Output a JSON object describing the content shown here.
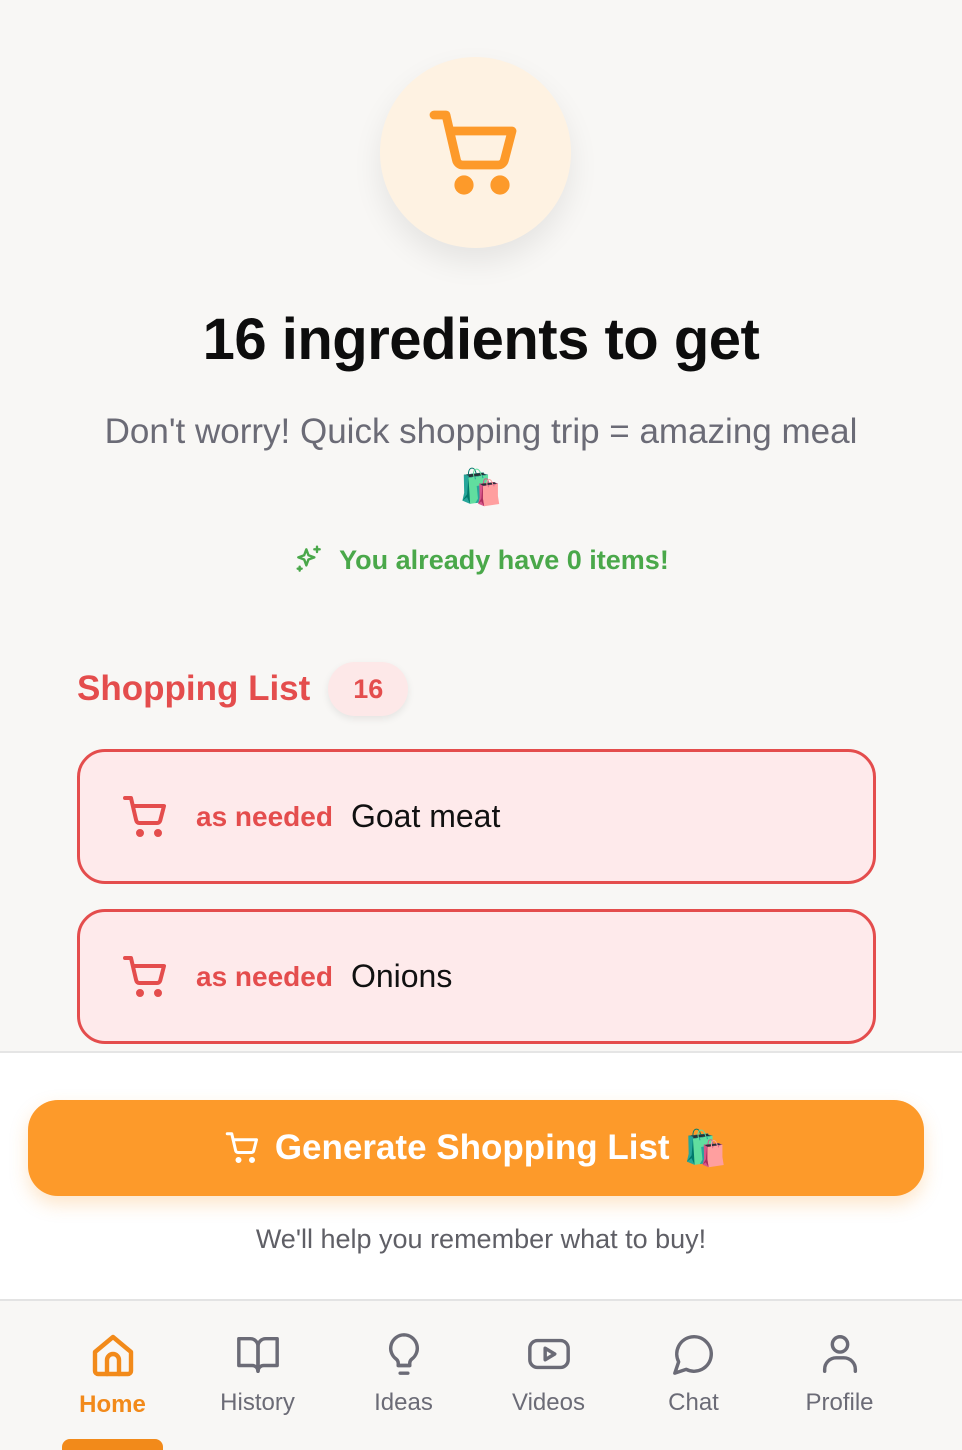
{
  "hero": {
    "icon": "shopping-cart-icon",
    "title": "16 ingredients to get",
    "subtitle": "Don't worry! Quick shopping trip = amazing meal",
    "subtitle_emoji": "🛍️",
    "already_text": "You already have 0 items!"
  },
  "shopping_list": {
    "title": "Shopping List",
    "count": "16",
    "items": [
      {
        "quantity": "as needed",
        "name": "Goat meat"
      },
      {
        "quantity": "as needed",
        "name": "Onions"
      }
    ]
  },
  "cta": {
    "label": "Generate Shopping List",
    "emoji": "🛍️",
    "helper": "We'll help you remember what to buy!"
  },
  "nav": {
    "items": [
      {
        "label": "Home",
        "icon": "home-icon",
        "active": true
      },
      {
        "label": "History",
        "icon": "book-icon"
      },
      {
        "label": "Ideas",
        "icon": "lightbulb-icon"
      },
      {
        "label": "Videos",
        "icon": "video-icon"
      },
      {
        "label": "Chat",
        "icon": "chat-bubble-icon"
      },
      {
        "label": "Profile",
        "icon": "user-icon"
      }
    ]
  },
  "colors": {
    "accent": "#fd9a2a",
    "danger": "#e44d4d",
    "success": "#4aa84a"
  }
}
